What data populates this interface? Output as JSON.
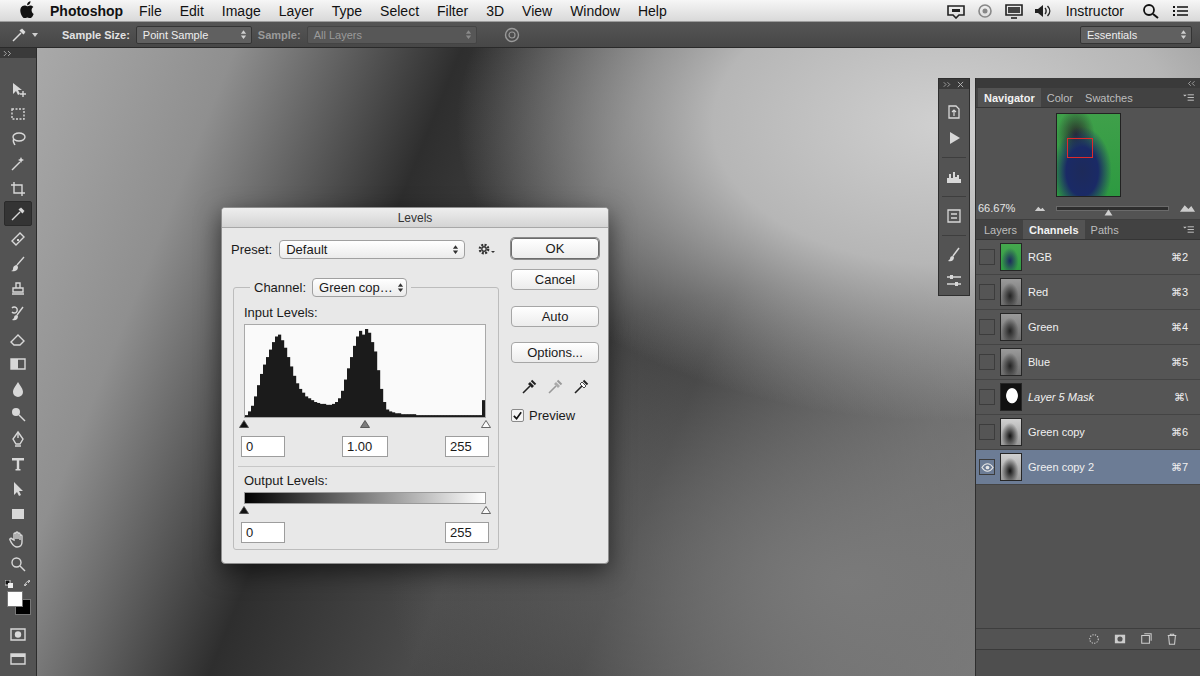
{
  "menu_bar": {
    "app": "Photoshop",
    "menus": [
      "File",
      "Edit",
      "Image",
      "Layer",
      "Type",
      "Select",
      "Filter",
      "3D",
      "View",
      "Window",
      "Help"
    ],
    "user": "Instructor"
  },
  "options_bar": {
    "sample_size_label": "Sample Size:",
    "sample_size": "Point Sample",
    "sample_label": "Sample:",
    "sample": "All Layers",
    "sample_disabled": true,
    "workspace": "Essentials"
  },
  "tools": [
    {
      "selected": false
    },
    {
      "selected": false
    },
    {
      "selected": false
    },
    {
      "selected": false
    },
    {
      "selected": false
    },
    {
      "selected": true
    },
    {
      "selected": false
    },
    {
      "selected": false
    },
    {
      "selected": false
    },
    {
      "selected": false
    },
    {
      "selected": false
    },
    {
      "selected": false
    },
    {
      "selected": false
    },
    {
      "selected": false
    },
    {
      "selected": false
    },
    {
      "selected": false
    },
    {
      "selected": false
    },
    {
      "selected": false
    },
    {
      "selected": false
    },
    {
      "selected": false
    }
  ],
  "color_swatches": {
    "foreground": "#ffffff",
    "background": "#000000"
  },
  "levels_dialog": {
    "title": "Levels",
    "preset_label": "Preset:",
    "preset": "Default",
    "channel_label": "Channel:",
    "channel": "Green cop…",
    "input_label": "Input Levels:",
    "histogram": [
      2,
      6,
      12,
      22,
      34,
      46,
      56,
      64,
      72,
      80,
      86,
      88,
      82,
      74,
      64,
      54,
      44,
      36,
      30,
      26,
      22,
      20,
      18,
      16,
      15,
      14,
      14,
      13,
      13,
      14,
      16,
      20,
      28,
      40,
      52,
      64,
      76,
      86,
      92,
      88,
      94,
      90,
      80,
      70,
      50,
      30,
      16,
      8,
      6,
      5,
      4,
      4,
      3,
      3,
      3,
      3,
      3,
      2,
      2,
      2,
      2,
      2,
      2,
      2,
      2,
      2,
      2,
      2,
      2,
      2,
      2,
      2,
      2,
      2,
      2,
      2,
      2,
      2,
      2,
      18
    ],
    "input_handles": [
      0,
      0.5,
      1
    ],
    "input_values": [
      "0",
      "1.00",
      "255"
    ],
    "output_label": "Output Levels:",
    "output_handles": [
      0,
      1
    ],
    "output_values": [
      "0",
      "255"
    ],
    "buttons": [
      {
        "label": "OK",
        "default": true
      },
      {
        "label": "Cancel",
        "default": false
      },
      {
        "label": "Auto",
        "default": false
      },
      {
        "label": "Options...",
        "default": false
      }
    ],
    "preview": {
      "label": "Preview",
      "checked": true
    }
  },
  "navigator_panel": {
    "tabs": [
      {
        "label": "Navigator",
        "selected": true
      },
      {
        "label": "Color",
        "selected": false
      },
      {
        "label": "Swatches",
        "selected": false
      }
    ],
    "zoom": "66.67%",
    "zoom_level": 0.46
  },
  "channels_panel": {
    "tabs": [
      {
        "label": "Layers",
        "selected": false
      },
      {
        "label": "Channels",
        "selected": true
      },
      {
        "label": "Paths",
        "selected": false
      }
    ],
    "channels": [
      {
        "name": "RGB",
        "shortcut": "⌘2",
        "kind": "composite",
        "visible": false,
        "selected": false
      },
      {
        "name": "Red",
        "shortcut": "⌘3",
        "kind": "channel",
        "visible": false,
        "selected": false
      },
      {
        "name": "Green",
        "shortcut": "⌘4",
        "kind": "channel",
        "visible": false,
        "selected": false
      },
      {
        "name": "Blue",
        "shortcut": "⌘5",
        "kind": "channel",
        "visible": false,
        "selected": false
      },
      {
        "name": "Layer 5 Mask",
        "shortcut": "⌘\\",
        "kind": "mask",
        "visible": false,
        "selected": false
      },
      {
        "name": "Green copy",
        "shortcut": "⌘6",
        "kind": "alpha",
        "visible": false,
        "selected": false
      },
      {
        "name": "Green copy 2",
        "shortcut": "⌘7",
        "kind": "alpha",
        "visible": true,
        "selected": true
      }
    ]
  }
}
